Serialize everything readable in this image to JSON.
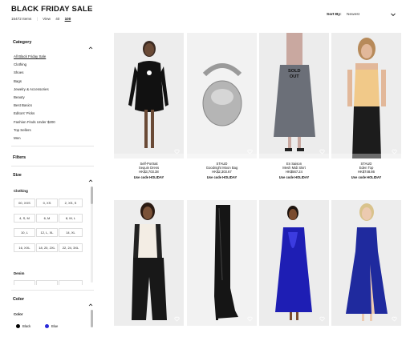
{
  "page": {
    "title": "BLACK FRIDAY SALE",
    "item_count": "15472 Items",
    "view_label": "View",
    "view_options": [
      "40",
      "100"
    ],
    "view_selected": "100"
  },
  "sort": {
    "label": "Sort By:",
    "value": "Newest"
  },
  "sidebar": {
    "category": {
      "heading": "Category",
      "items": [
        "All Black Friday Sale",
        "Clothing",
        "Shoes",
        "Bags",
        "Jewelry & Accessories",
        "Beauty",
        "Best Basics",
        "Editors' Picks",
        "Fashion Finds Under $200",
        "Top Sellers",
        "Men"
      ],
      "active": "All Black Friday Sale"
    },
    "filters": {
      "heading": "Filters"
    },
    "size": {
      "heading": "Size",
      "clothing_label": "Clothing",
      "chips": [
        "00, XXS",
        "0, XS",
        "2, XS, S",
        "4, S, M",
        "6, M",
        "8, M, L",
        "10, L",
        "12, L, XL",
        "14, XL",
        "16, XXL",
        "18, 20, 2XL",
        "22, 24, 3XL"
      ],
      "denim_label": "Denim"
    },
    "color": {
      "heading": "Color",
      "sub_label": "Color",
      "swatches": [
        {
          "name": "Black",
          "hex": "#000000"
        },
        {
          "name": "Blue",
          "hex": "#2a2ad8"
        }
      ]
    }
  },
  "products": [
    {
      "brand": "Self-Portrait",
      "name": "Sequin Dress",
      "price": "HK$3,703.38",
      "code": "Use code HOLIDAY",
      "sold_out": false
    },
    {
      "brand": "STAUD",
      "name": "Goodnight Moon Bag",
      "price": "HK$2,303.67",
      "code": "Use code HOLIDAY",
      "sold_out": false
    },
    {
      "brand": "En Saison",
      "name": "Mesh Midi Skirt",
      "price": "HK$567.24",
      "code": "Use code HOLIDAY",
      "sold_out": true,
      "sold_label": "SOLD OUT"
    },
    {
      "brand": "STAUD",
      "name": "Eden Top",
      "price": "HK$748.86",
      "code": "Use code HOLIDAY",
      "sold_out": false
    },
    {
      "brand": "",
      "name": "",
      "price": "",
      "code": "",
      "sold_out": false
    },
    {
      "brand": "",
      "name": "",
      "price": "",
      "code": "",
      "sold_out": false
    },
    {
      "brand": "",
      "name": "",
      "price": "",
      "code": "",
      "sold_out": false
    },
    {
      "brand": "",
      "name": "",
      "price": "",
      "code": "",
      "sold_out": false
    }
  ],
  "icons": {
    "sort_chevron": "chevron-down-icon",
    "section_chevron_up": "chevron-up-icon",
    "favorite": "heart-icon"
  }
}
